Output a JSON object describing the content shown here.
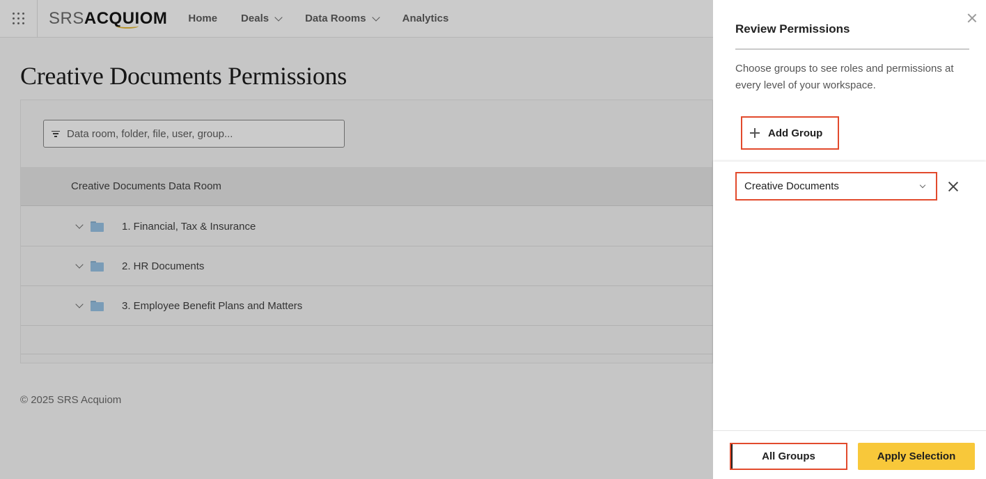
{
  "nav": {
    "logo_light": "SRS",
    "logo_bold": "ACQUIOM",
    "items": [
      {
        "label": "Home"
      },
      {
        "label": "Deals"
      },
      {
        "label": "Data Rooms"
      },
      {
        "label": "Analytics"
      }
    ]
  },
  "page": {
    "title": "Creative Documents Permissions",
    "filter_placeholder": "Data room, folder, file, user, group...",
    "table_header": "Creative Documents Data Room",
    "rows": [
      {
        "label": "1. Financial, Tax & Insurance"
      },
      {
        "label": "2. HR Documents"
      },
      {
        "label": "3. Employee Benefit Plans and Matters"
      }
    ],
    "copyright": "© 2025 SRS Acquiom"
  },
  "drawer": {
    "title": "Review Permissions",
    "description": "Choose groups to see roles and permissions at every level of your workspace.",
    "add_group_label": "Add Group",
    "selected_group": "Creative Documents",
    "all_groups_label": "All Groups",
    "apply_label": "Apply Selection"
  },
  "colors": {
    "accent_yellow": "#f8c83a",
    "highlight_red": "#e24a2c",
    "folder_blue": "#7a9cb7"
  }
}
